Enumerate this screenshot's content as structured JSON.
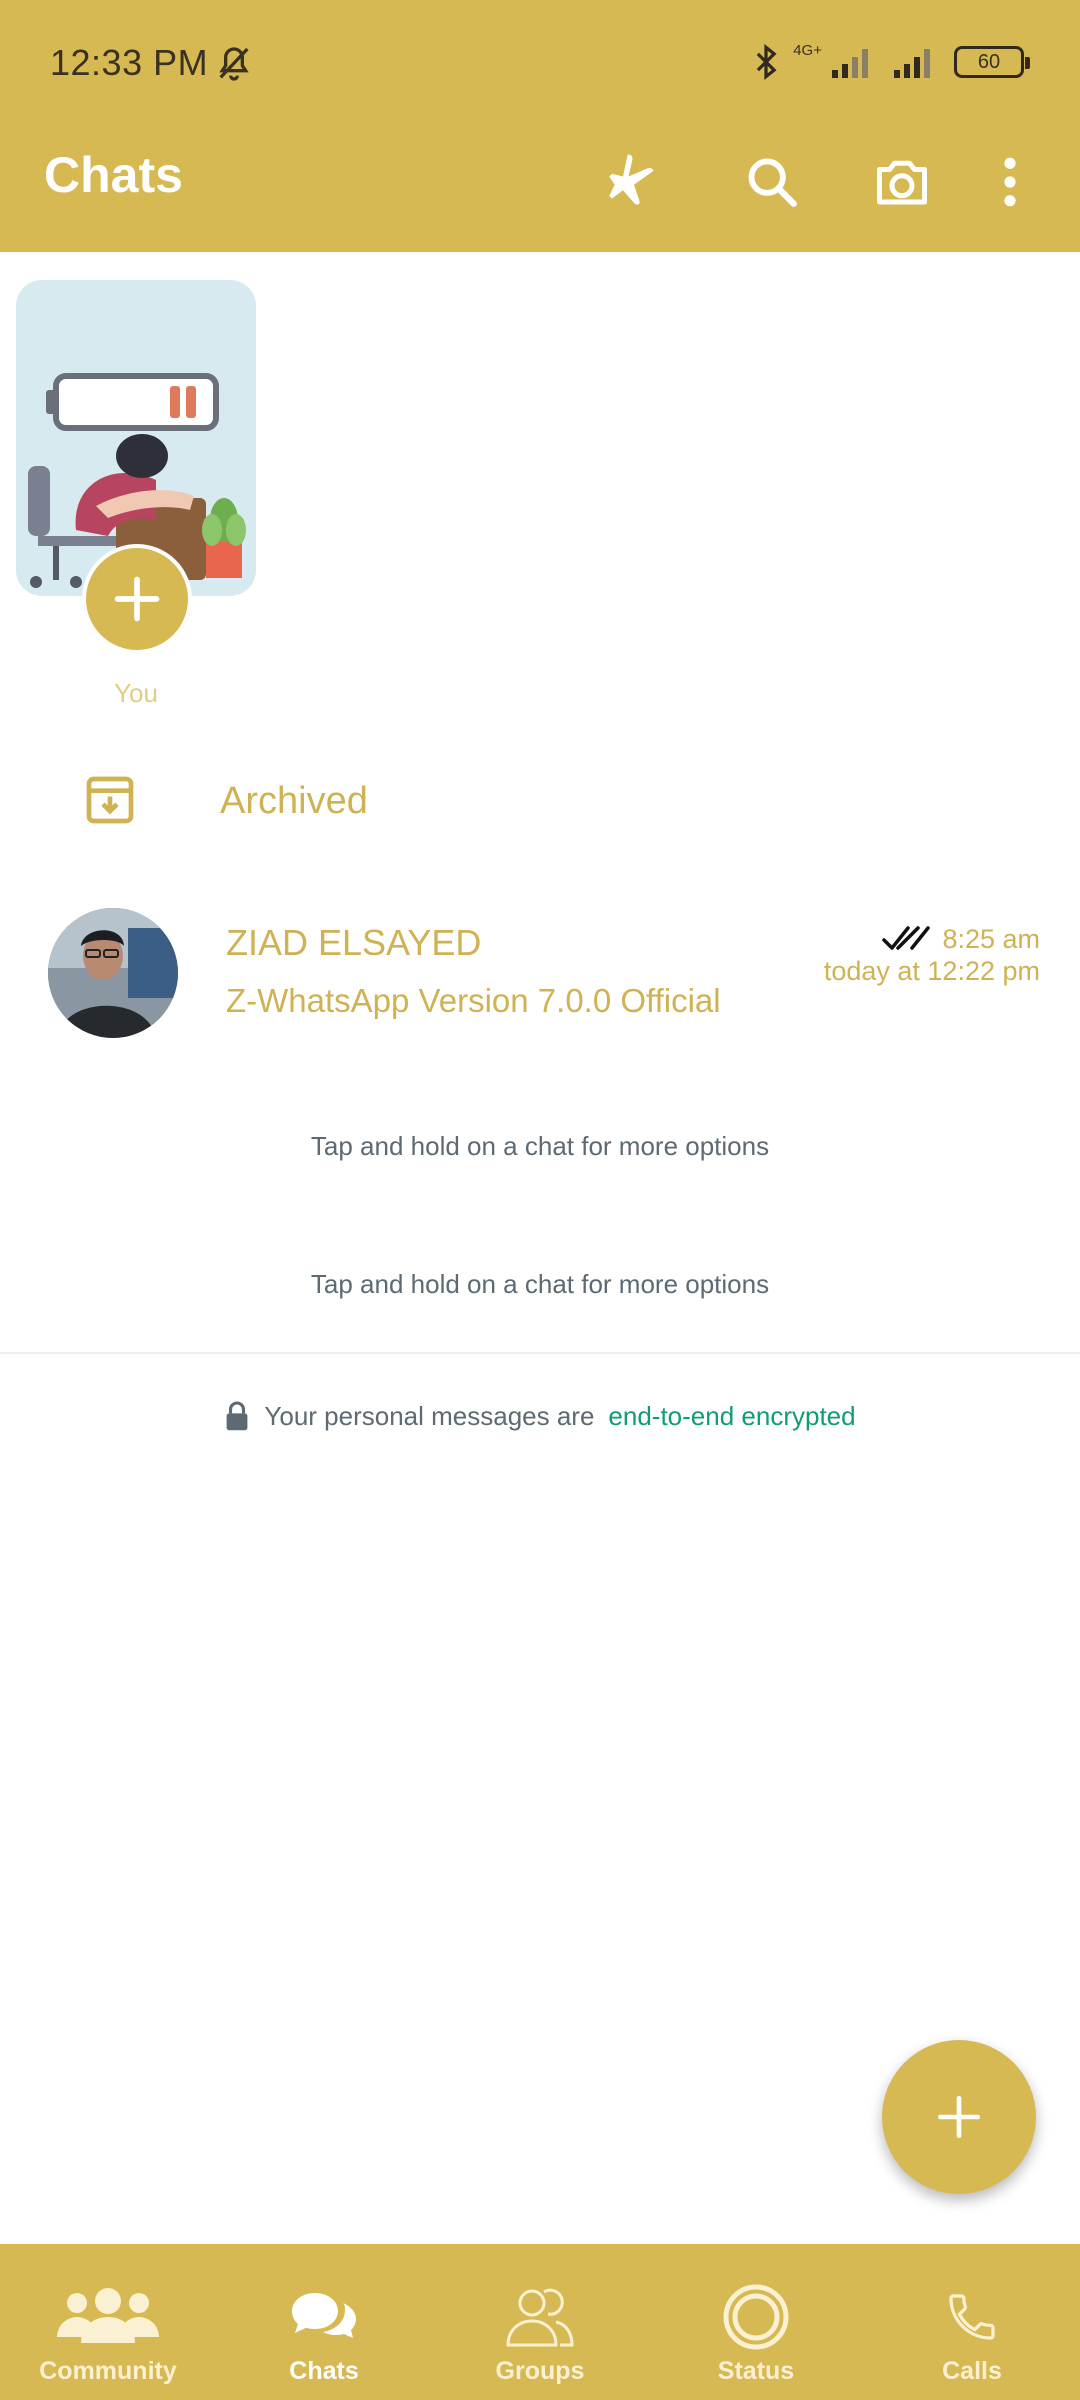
{
  "status_bar": {
    "time": "12:33 PM",
    "network_label": "4G+",
    "battery": "60",
    "icons": [
      "bell-off-icon",
      "bluetooth-icon",
      "signal-icon",
      "battery-icon"
    ]
  },
  "app_bar": {
    "title": "Chats",
    "icons": [
      "flight-mode-icon",
      "search-icon",
      "camera-icon",
      "more-vert-icon"
    ]
  },
  "story": {
    "label": "You"
  },
  "archived": {
    "label": "Archived"
  },
  "chats": [
    {
      "name": "ZIAD ELSAYED",
      "preview": "Z-WhatsApp Version 7.0.0 Official",
      "time": "8:25 am",
      "date": "today at 12:22 pm"
    }
  ],
  "hints": [
    "Tap and hold on a chat for more options",
    "Tap and hold on a chat for more options"
  ],
  "encryption": {
    "text": "Your personal messages are",
    "link": "end-to-end encrypted"
  },
  "bottom_nav": [
    {
      "label": "Community",
      "icon": "community-icon"
    },
    {
      "label": "Chats",
      "icon": "chats-icon",
      "active": true
    },
    {
      "label": "Groups",
      "icon": "groups-icon"
    },
    {
      "label": "Status",
      "icon": "status-icon"
    },
    {
      "label": "Calls",
      "icon": "calls-icon"
    }
  ],
  "colors": {
    "theme": "#d7b953",
    "accent_text": "#cfb253",
    "link": "#0f9d76"
  }
}
